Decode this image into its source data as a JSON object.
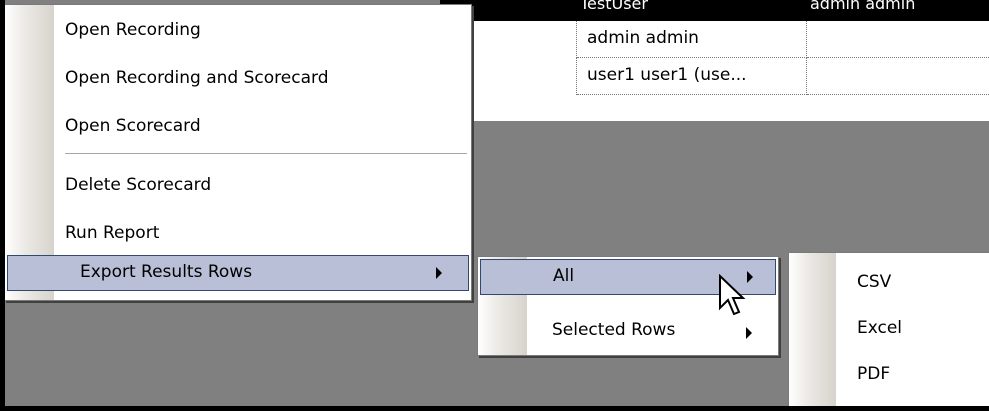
{
  "background_grid": {
    "header_cells": [
      "TestUser",
      "admin admin"
    ],
    "rows": [
      [
        "admin admin",
        ""
      ],
      [
        "user1 user1 (use...",
        ""
      ]
    ]
  },
  "context_menu": {
    "items": [
      {
        "label": "Open Recording"
      },
      {
        "label": "Open Recording and Scorecard"
      },
      {
        "label": "Open Scorecard"
      },
      {
        "label": "Delete Scorecard"
      },
      {
        "label": "Run Report"
      },
      {
        "label": "Export Results Rows",
        "highlighted": true,
        "has_submenu": true
      }
    ]
  },
  "export_submenu": {
    "items": [
      {
        "label": "All",
        "highlighted": true,
        "has_submenu": true
      },
      {
        "label": "Selected Rows",
        "has_submenu": true
      }
    ]
  },
  "format_submenu": {
    "items": [
      {
        "label": "CSV"
      },
      {
        "label": "Excel"
      },
      {
        "label": "PDF"
      }
    ]
  },
  "colors": {
    "highlight": "#b8bfd6",
    "highlight_border": "#31496e",
    "desktop_gray": "#808080"
  },
  "icons": [
    "submenu-arrow-icon",
    "mouse-pointer-icon"
  ]
}
